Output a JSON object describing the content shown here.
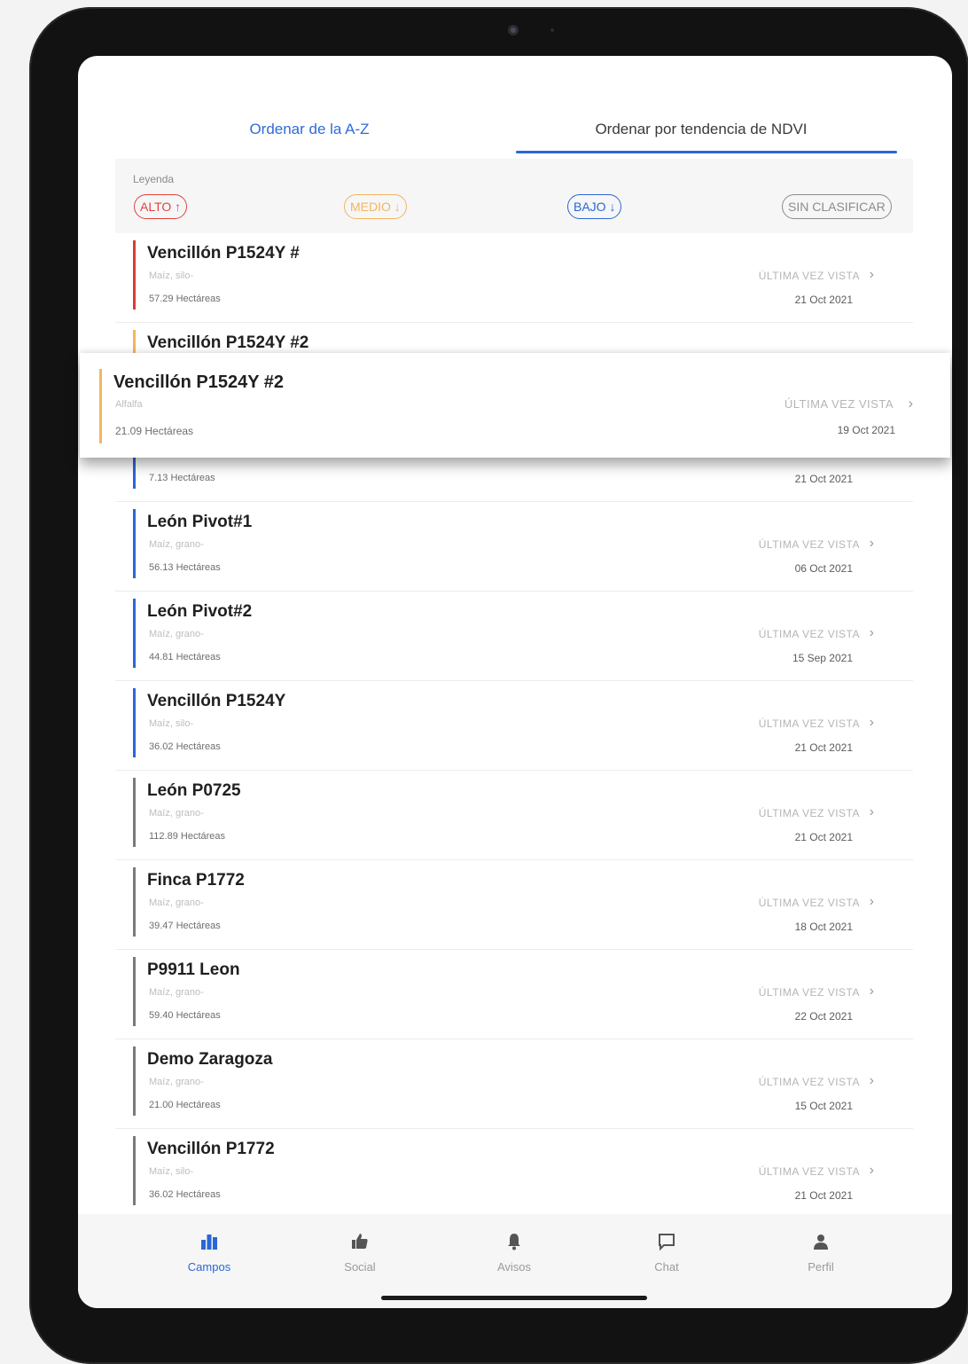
{
  "tabs": {
    "az": "Ordenar de la A-Z",
    "ndvi": "Ordenar por tendencia de NDVI"
  },
  "legend": {
    "title": "Leyenda",
    "alto": "ALTO ↑",
    "medio": "MEDIO ↓",
    "bajo": "BAJO ↓",
    "sin": "SIN CLASIFICAR"
  },
  "list_label": "ÚLTIMA VEZ VISTA",
  "rows": [
    {
      "name": "Vencillón P1524Y #",
      "crop": "Maíz, silo-",
      "area": "57.29 Hectáreas",
      "date": "21 Oct 2021",
      "color": "#d83c34"
    },
    {
      "name": "Vencillón P1524Y #2",
      "crop": "",
      "area": "",
      "date": "",
      "color": "#f2b55e"
    },
    {
      "name": "",
      "crop": "",
      "area": "7.13 Hectáreas",
      "date": "21 Oct 2021",
      "color": "#2a66d6"
    },
    {
      "name": "León Pivot#1",
      "crop": "Maíz, grano-",
      "area": "56.13 Hectáreas",
      "date": "06 Oct 2021",
      "color": "#2a66d6"
    },
    {
      "name": "León Pivot#2",
      "crop": "Maíz, grano-",
      "area": "44.81 Hectáreas",
      "date": "15 Sep 2021",
      "color": "#2a66d6"
    },
    {
      "name": "Vencillón P1524Y",
      "crop": "Maíz, silo-",
      "area": "36.02 Hectáreas",
      "date": "21 Oct 2021",
      "color": "#2a66d6"
    },
    {
      "name": "León P0725",
      "crop": "Maíz, grano-",
      "area": "112.89 Hectáreas",
      "date": "21 Oct 2021",
      "color": "#7a7a7a"
    },
    {
      "name": "Finca P1772",
      "crop": "Maíz, grano-",
      "area": "39.47 Hectáreas",
      "date": "18 Oct 2021",
      "color": "#7a7a7a"
    },
    {
      "name": "P9911 Leon",
      "crop": "Maíz, grano-",
      "area": "59.40 Hectáreas",
      "date": "22 Oct 2021",
      "color": "#7a7a7a"
    },
    {
      "name": "Demo Zaragoza",
      "crop": "Maíz, grano-",
      "area": "21.00 Hectáreas",
      "date": "15 Oct 2021",
      "color": "#7a7a7a"
    },
    {
      "name": "Vencillón P1772",
      "crop": "Maíz, silo-",
      "area": "36.02 Hectáreas",
      "date": "21 Oct 2021",
      "color": "#7a7a7a"
    }
  ],
  "dragged": {
    "name": "Vencillón P1524Y #2",
    "crop": "Alfalfa",
    "area": "21.09 Hectáreas",
    "date": "19 Oct 2021",
    "color": "#f2b55e"
  },
  "nav": [
    {
      "label": "Campos",
      "icon": "fields-icon",
      "active": true
    },
    {
      "label": "Social",
      "icon": "thumbs-up-icon"
    },
    {
      "label": "Avisos",
      "icon": "bell-icon"
    },
    {
      "label": "Chat",
      "icon": "chat-icon"
    },
    {
      "label": "Perfil",
      "icon": "person-icon"
    }
  ]
}
